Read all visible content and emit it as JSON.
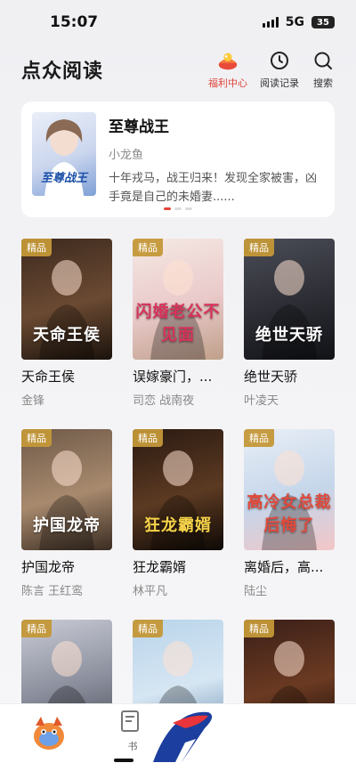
{
  "status": {
    "time": "15:07",
    "network": "5G",
    "battery": "35"
  },
  "header": {
    "title": "点众阅读",
    "actions": [
      {
        "label": "福利中心",
        "icon": "gift-icon"
      },
      {
        "label": "阅读记录",
        "icon": "clock-icon"
      },
      {
        "label": "搜索",
        "icon": "search-icon"
      }
    ]
  },
  "featured": {
    "title": "至尊战王",
    "author": "小龙鱼",
    "description": "十年戎马，战王归来！发现全家被害，凶手竟是自己的未婚妻......",
    "cover_text": "至尊战王",
    "pages": 3,
    "active_page": 0
  },
  "badge_label": "精品",
  "books": [
    {
      "title": "天命王侯",
      "author": "金锋",
      "cover_text": "天命王侯",
      "colors": [
        "#3d2a1f",
        "#6b4a32",
        "#1a120c"
      ],
      "text_color": "#ffffff"
    },
    {
      "title": "误嫁豪门，...",
      "author": "司恋  战南夜",
      "cover_text": "闪婚老公不见面",
      "colors": [
        "#f5e9e4",
        "#e9c9c9",
        "#bfa08a"
      ],
      "text_color": "#d9325a"
    },
    {
      "title": "绝世天骄",
      "author": "叶凌天",
      "cover_text": "绝世天骄",
      "colors": [
        "#4b4d57",
        "#2c2d34",
        "#111216"
      ],
      "text_color": "#ffffff"
    },
    {
      "title": "护国龙帝",
      "author": "陈言  王红鸾",
      "cover_text": "护国龙帝",
      "colors": [
        "#6f5a49",
        "#a88a6e",
        "#3a2c22"
      ],
      "text_color": "#ffffff"
    },
    {
      "title": "狂龙霸婿",
      "author": "林平凡",
      "cover_text": "狂龙霸婿",
      "colors": [
        "#2a1a12",
        "#5c3a22",
        "#0e0906"
      ],
      "text_color": "#f7d34a"
    },
    {
      "title": "离婚后，高...",
      "author": "陆尘",
      "cover_text": "高冷女总裁后悔了",
      "colors": [
        "#e8eef6",
        "#c5d6ea",
        "#f2c6c6"
      ],
      "text_color": "#e04a3c"
    },
    {
      "title": "",
      "author": "",
      "cover_text": "",
      "colors": [
        "#c9ccd6",
        "#8a8e9c",
        "#4a4d58"
      ],
      "text_color": "#ffffff"
    },
    {
      "title": "",
      "author": "",
      "cover_text": "",
      "colors": [
        "#b9d4ea",
        "#d6e6f3",
        "#6e8fb0"
      ],
      "text_color": "#ffffff"
    },
    {
      "title": "",
      "author": "",
      "cover_text": "",
      "colors": [
        "#3a1f18",
        "#6b3a22",
        "#1a0d08"
      ],
      "text_color": "#ffffff"
    }
  ],
  "bottom_nav": {
    "shelf_label": "书"
  }
}
